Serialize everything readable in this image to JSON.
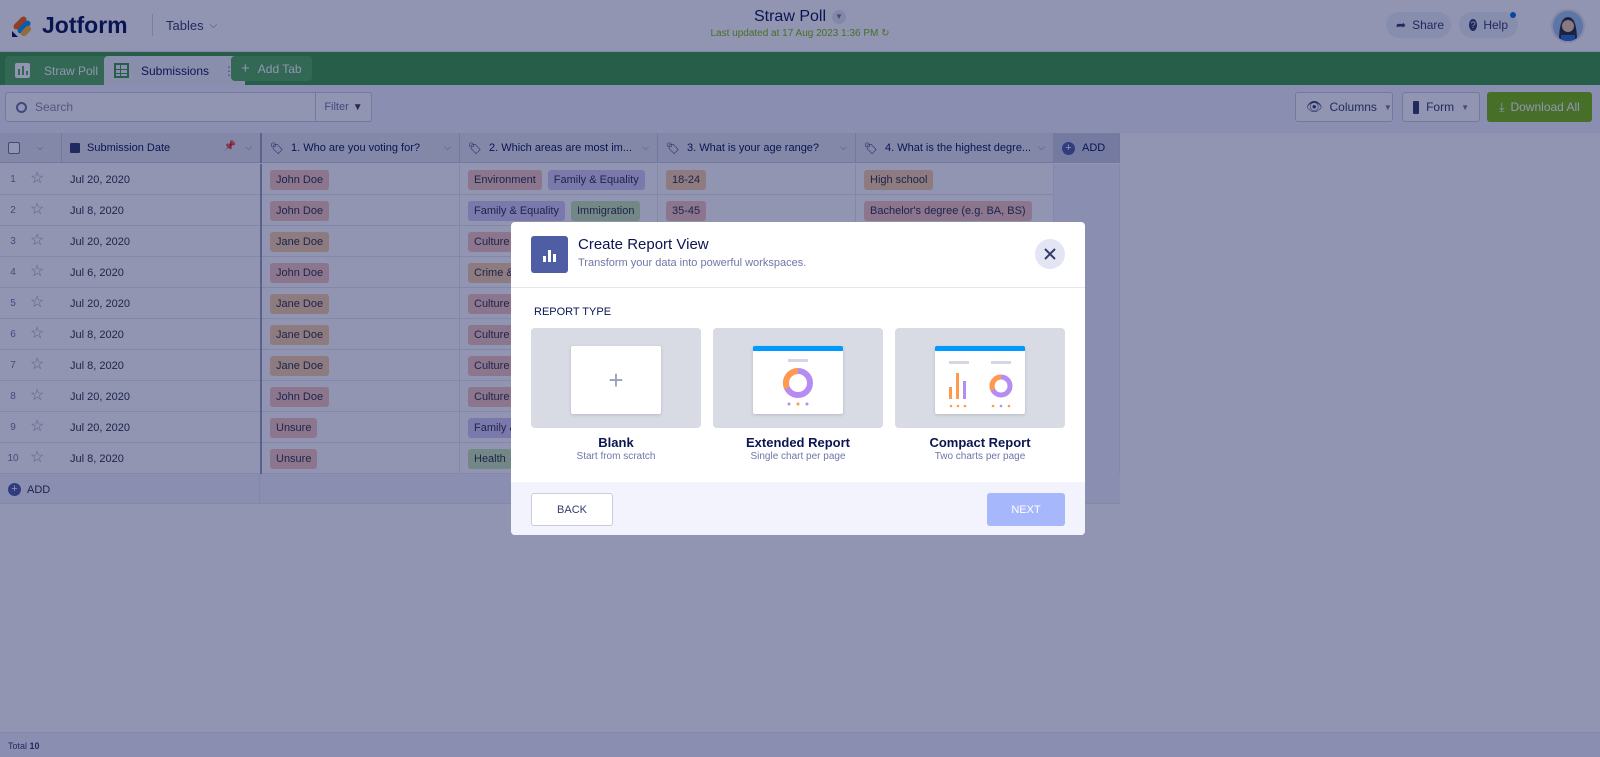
{
  "header": {
    "logo_text": "Jotform",
    "workspace_menu": "Tables",
    "title": "Straw Poll",
    "last_updated": "Last updated at 17 Aug 2023 1:36 PM",
    "share_label": "Share",
    "help_label": "Help"
  },
  "tabs": {
    "straw_poll": "Straw Poll",
    "submissions": "Submissions",
    "add_tab": "Add Tab"
  },
  "toolbar": {
    "search_placeholder": "Search",
    "filter_label": "Filter",
    "columns_label": "Columns",
    "form_label": "Form",
    "download_label": "Download All"
  },
  "table": {
    "columns": [
      "Submission Date",
      "1. Who are you voting for?",
      "2. Which areas are most im...",
      "3. What is your age range?",
      "4. What is the highest degre..."
    ],
    "add_column_label": "ADD",
    "rows": [
      {
        "num": "1",
        "date": "Jul 20, 2020",
        "vote": "John Doe",
        "areas": [
          "Environment",
          "Family & Equality"
        ],
        "age": "18-24",
        "degree": "High school"
      },
      {
        "num": "2",
        "date": "Jul 8, 2020",
        "vote": "John Doe",
        "areas": [
          "Family & Equality",
          "Immigration"
        ],
        "age": "35-45",
        "degree": "Bachelor's degree (e.g. BA, BS)"
      },
      {
        "num": "3",
        "date": "Jul 20, 2020",
        "vote": "Jane Doe",
        "areas": [
          "Culture"
        ],
        "age": "",
        "degree": ""
      },
      {
        "num": "4",
        "date": "Jul 6, 2020",
        "vote": "John Doe",
        "areas": [
          "Crime &"
        ],
        "age": "",
        "degree": ""
      },
      {
        "num": "5",
        "date": "Jul 20, 2020",
        "vote": "Jane Doe",
        "areas": [
          "Culture"
        ],
        "age": "",
        "degree": ""
      },
      {
        "num": "6",
        "date": "Jul 8, 2020",
        "vote": "Jane Doe",
        "areas": [
          "Culture"
        ],
        "age": "",
        "degree": ""
      },
      {
        "num": "7",
        "date": "Jul 8, 2020",
        "vote": "Jane Doe",
        "areas": [
          "Culture"
        ],
        "age": "",
        "degree": ""
      },
      {
        "num": "8",
        "date": "Jul 20, 2020",
        "vote": "John Doe",
        "areas": [
          "Culture"
        ],
        "age": "",
        "degree": ""
      },
      {
        "num": "9",
        "date": "Jul 20, 2020",
        "vote": "Unsure",
        "areas": [
          "Family &"
        ],
        "age": "",
        "degree": ""
      },
      {
        "num": "10",
        "date": "Jul 8, 2020",
        "vote": "Unsure",
        "areas": [
          "Health"
        ],
        "age": "",
        "degree": ""
      }
    ],
    "add_row_label": "ADD"
  },
  "footer": {
    "total_label": "Total",
    "total_value": "10"
  },
  "modal": {
    "title": "Create Report View",
    "subtitle": "Transform your data into powerful workspaces.",
    "section_label": "REPORT TYPE",
    "cards": [
      {
        "name": "Blank",
        "desc": "Start from scratch"
      },
      {
        "name": "Extended Report",
        "desc": "Single chart per page"
      },
      {
        "name": "Compact Report",
        "desc": "Two charts per page"
      }
    ],
    "back_label": "BACK",
    "next_label": "NEXT"
  },
  "colors": {
    "tab_bar": "#3e9b43",
    "download": "#78bb07",
    "next_disabled": "#a7b7fc",
    "chip_orange": "#f9cfa6",
    "chip_red": "#f6c6c0",
    "chip_purple": "#d7cdf5",
    "chip_green": "#cbe5b3"
  }
}
